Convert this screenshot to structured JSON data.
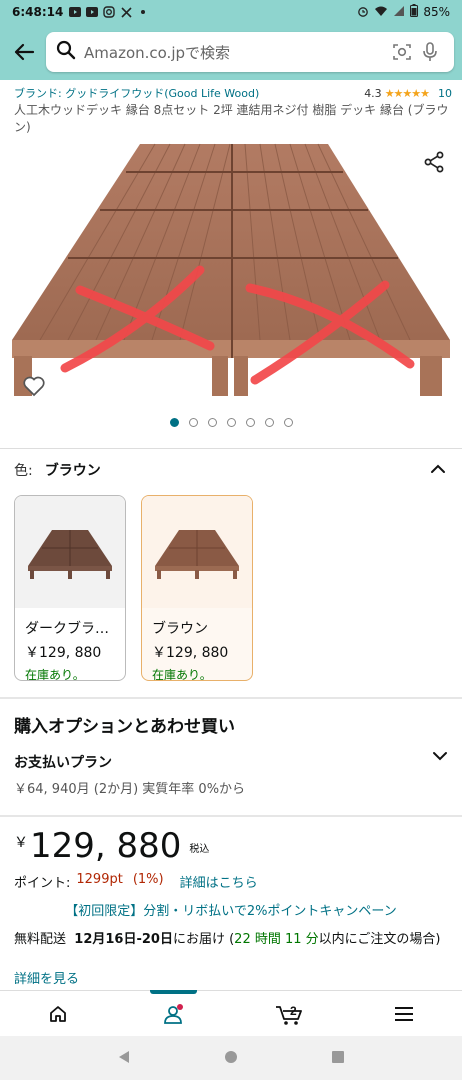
{
  "status_bar": {
    "time": "6:48:14",
    "battery": "85%",
    "icons": [
      "youtube-icon",
      "youtube-icon",
      "instagram-icon",
      "x-icon",
      "dot-icon"
    ]
  },
  "search": {
    "placeholder": "Amazon.co.jpで検索"
  },
  "product": {
    "brand": "ブランド: グッドライフウッド(Good Life Wood)",
    "rating": "4.3",
    "rating_stars": "★★★★★",
    "review_count": "10",
    "title": "人工木ウッドデッキ 縁台 8点セット 2坪 連結用ネジ付 樹脂 デッキ 縁台 (ブラウン)"
  },
  "gallery": {
    "total": 7,
    "active_index": 0
  },
  "color": {
    "label": "色:",
    "selected": "ブラウン",
    "options": [
      {
        "name": "ダークブラ…",
        "price": "￥129, 880",
        "stock": "在庫あり。"
      },
      {
        "name": "ブラウン",
        "price": "￥129, 880",
        "stock": "在庫あり。"
      }
    ]
  },
  "purchase": {
    "section_title": "購入オプションとあわせ買い",
    "pay_plan_title": "お支払いプラン",
    "pay_plan_sub": "￥64, 940月 (2か月) 実質年率 0%から"
  },
  "pricing": {
    "yen": "￥",
    "amount": "129, 880",
    "tax": "税込",
    "points_label": "ポイント:",
    "points_value": "1299pt",
    "points_pct": "(1%)",
    "points_link": "詳細はこちら",
    "campaign": "【初回限定】分割・リボ払いで2%ポイントキャンペーン"
  },
  "delivery": {
    "prefix": "無料配送",
    "date": "12月16日-20日",
    "mid": "にお届け (",
    "countdown": "22 時間 11 分",
    "suffix": "以内にご注文の場合)",
    "link": "詳細を見る"
  },
  "tabs": {
    "cart_count": "2"
  },
  "colors": {
    "header_bg": "#8ED4CE",
    "link": "#007185",
    "price_red": "#B12704",
    "in_stock": "#007600",
    "star": "#F4A41C"
  }
}
